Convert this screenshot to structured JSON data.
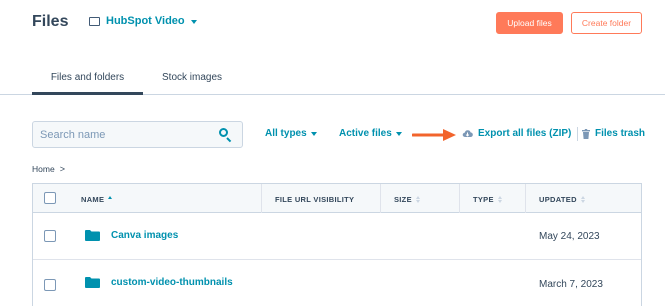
{
  "header": {
    "title": "Files",
    "account_label": "HubSpot Video",
    "upload_label": "Upload files",
    "create_folder_label": "Create folder"
  },
  "tabs": [
    {
      "label": "Files and folders",
      "active": true
    },
    {
      "label": "Stock images",
      "active": false
    }
  ],
  "toolbar": {
    "search_placeholder": "Search name",
    "types_filter": "All types",
    "status_filter": "Active files",
    "export_label": "Export all files (ZIP)",
    "trash_label": "Files trash"
  },
  "breadcrumb": {
    "home": "Home",
    "separator": ">"
  },
  "table": {
    "columns": [
      {
        "label": "NAME",
        "sort": "ascending"
      },
      {
        "label": "FILE URL VISIBILITY",
        "sort": "none"
      },
      {
        "label": "SIZE",
        "sort": "unsorted"
      },
      {
        "label": "TYPE",
        "sort": "unsorted"
      },
      {
        "label": "UPDATED",
        "sort": "unsorted"
      }
    ],
    "rows": [
      {
        "name": "Canva images",
        "kind": "folder",
        "updated": "May 24, 2023"
      },
      {
        "name": "custom-video-thumbnails",
        "kind": "folder",
        "updated": "March 7, 2023"
      }
    ]
  },
  "colors": {
    "accent": "#0091ae",
    "primary_button": "#ff7a59",
    "annotation_arrow": "#f2642c",
    "text": "#33475b"
  }
}
